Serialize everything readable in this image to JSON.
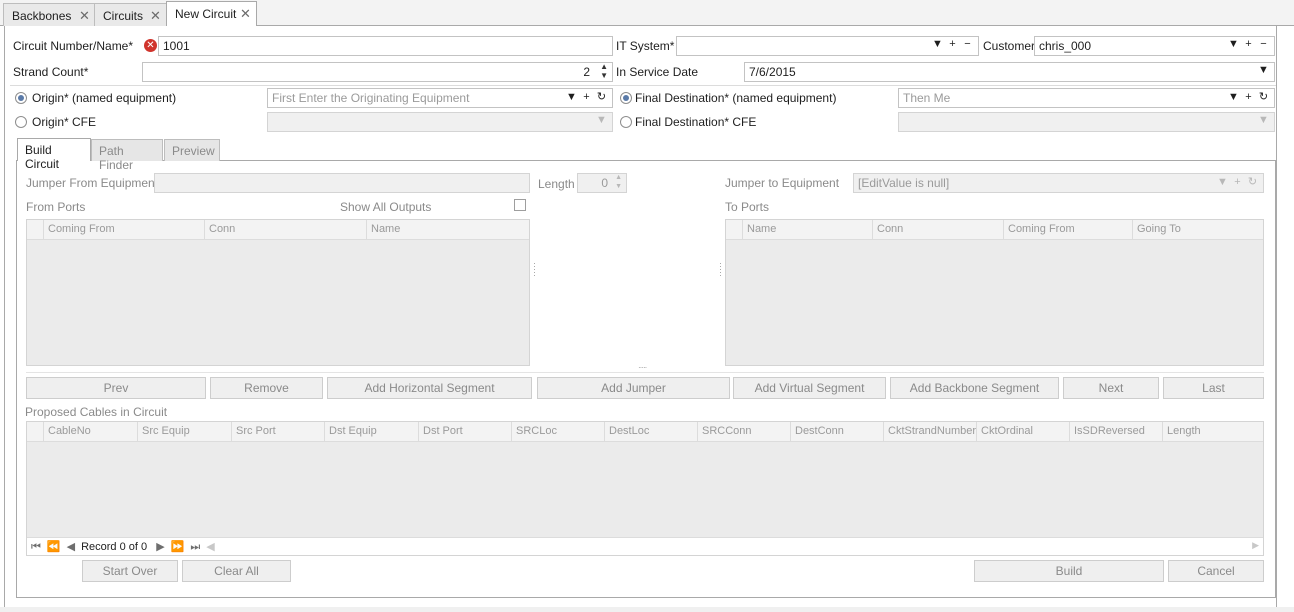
{
  "doc_tabs": [
    {
      "label": "Backbones"
    },
    {
      "label": "Circuits"
    },
    {
      "label": "New Circuit"
    }
  ],
  "form": {
    "circuit_label": "Circuit Number/Name*",
    "circuit_value": "1001",
    "it_system_label": "IT System*",
    "it_system_value": "",
    "customer_label": "Customer",
    "customer_value": "chris_000",
    "strand_label": "Strand Count*",
    "strand_value": "2",
    "in_service_label": "In Service Date",
    "in_service_value": "7/6/2015",
    "origin_named_label": "Origin* (named equipment)",
    "origin_named_placeholder": "First Enter the Originating Equipment",
    "final_named_label": "Final Destination* (named equipment)",
    "final_named_placeholder": "Then Me",
    "origin_cfe_label": "Origin*  CFE",
    "final_cfe_label": "Final Destination* CFE"
  },
  "inner_tabs": [
    {
      "label": "Build Circuit"
    },
    {
      "label": "Path Finder"
    },
    {
      "label": "Preview"
    }
  ],
  "build": {
    "jumper_from_label": "Jumper From Equipment",
    "length_label": "Length",
    "length_value": "0",
    "jumper_to_label": "Jumper to Equipment",
    "jumper_to_value": "[EditValue is null]",
    "from_ports_label": "From Ports",
    "show_all_label": "Show All Outputs",
    "to_ports_label": "To Ports",
    "from_columns": [
      "Coming From",
      "Conn",
      "Name"
    ],
    "to_columns": [
      "Name",
      "Conn",
      "Coming From",
      "Going To"
    ],
    "buttons": [
      "Prev",
      "Remove",
      "Add Horizontal Segment",
      "Add Jumper",
      "Add Virtual Segment",
      "Add Backbone Segment",
      "Next",
      "Last"
    ],
    "proposed_label": "Proposed Cables in Circuit",
    "cable_columns": [
      "CableNo",
      "Src Equip",
      "Src Port",
      "Dst Equip",
      "Dst Port",
      "SRCLoc",
      "DestLoc",
      "SRCConn",
      "DestConn",
      "CktStrandNumber",
      "CktOrdinal",
      "IsSDReversed",
      "Length"
    ],
    "record_text": "Record 0 of 0"
  },
  "footer": {
    "start_over": "Start Over",
    "clear_all": "Clear All",
    "build": "Build",
    "cancel": "Cancel"
  }
}
